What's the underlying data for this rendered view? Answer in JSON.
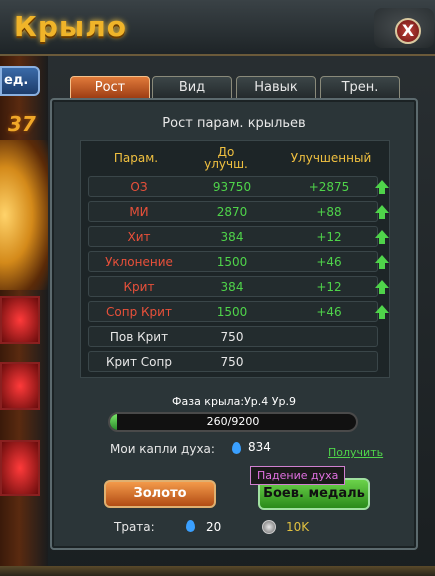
{
  "window": {
    "title": "Крыло",
    "close_label": "X"
  },
  "side": {
    "button_label": "ед.",
    "number": "37"
  },
  "tabs": [
    {
      "label": "Рост",
      "active": true
    },
    {
      "label": "Вид",
      "active": false
    },
    {
      "label": "Навык",
      "active": false
    },
    {
      "label": "Трен.",
      "active": false
    }
  ],
  "panel_title": "Рост парам. крыльев",
  "table": {
    "headers": {
      "param": "Парам.",
      "before": "До улучш.",
      "after": "Улучшенный"
    },
    "rows": [
      {
        "name": "ОЗ",
        "value": "93750",
        "bonus": "+2875",
        "upgradable": true,
        "color": "#e8503a"
      },
      {
        "name": "МИ",
        "value": "2870",
        "bonus": "+88",
        "upgradable": true,
        "color": "#e8503a"
      },
      {
        "name": "Хит",
        "value": "384",
        "bonus": "+12",
        "upgradable": true,
        "color": "#e8503a"
      },
      {
        "name": "Уклонение",
        "value": "1500",
        "bonus": "+46",
        "upgradable": true,
        "color": "#e8503a"
      },
      {
        "name": "Крит",
        "value": "384",
        "bonus": "+12",
        "upgradable": true,
        "color": "#e8503a"
      },
      {
        "name": "Сопр Крит",
        "value": "1500",
        "bonus": "+46",
        "upgradable": true,
        "color": "#e8503a"
      },
      {
        "name": "Пов Крит",
        "value": "750",
        "bonus": "",
        "upgradable": false,
        "color": "#e8e8e8"
      },
      {
        "name": "Крит Сопр",
        "value": "750",
        "bonus": "",
        "upgradable": false,
        "color": "#e8e8e8"
      }
    ]
  },
  "phase": "Фаза крыла:Ур.4 Ур.9",
  "progress": {
    "text": "260/9200",
    "fraction": 0.0283
  },
  "drops": {
    "label": "Мои капли духа:",
    "value": "834",
    "get_link": "Получить"
  },
  "buttons": {
    "gold": "Золото",
    "medal": "Боев. медаль"
  },
  "tooltip": "Падение духа",
  "cost": {
    "label": "Трата:",
    "drops": "20",
    "coins": "10K"
  },
  "colors": {
    "value": "#4fd44a",
    "bonus": "#4fd44a",
    "accent": "#f0b429"
  }
}
